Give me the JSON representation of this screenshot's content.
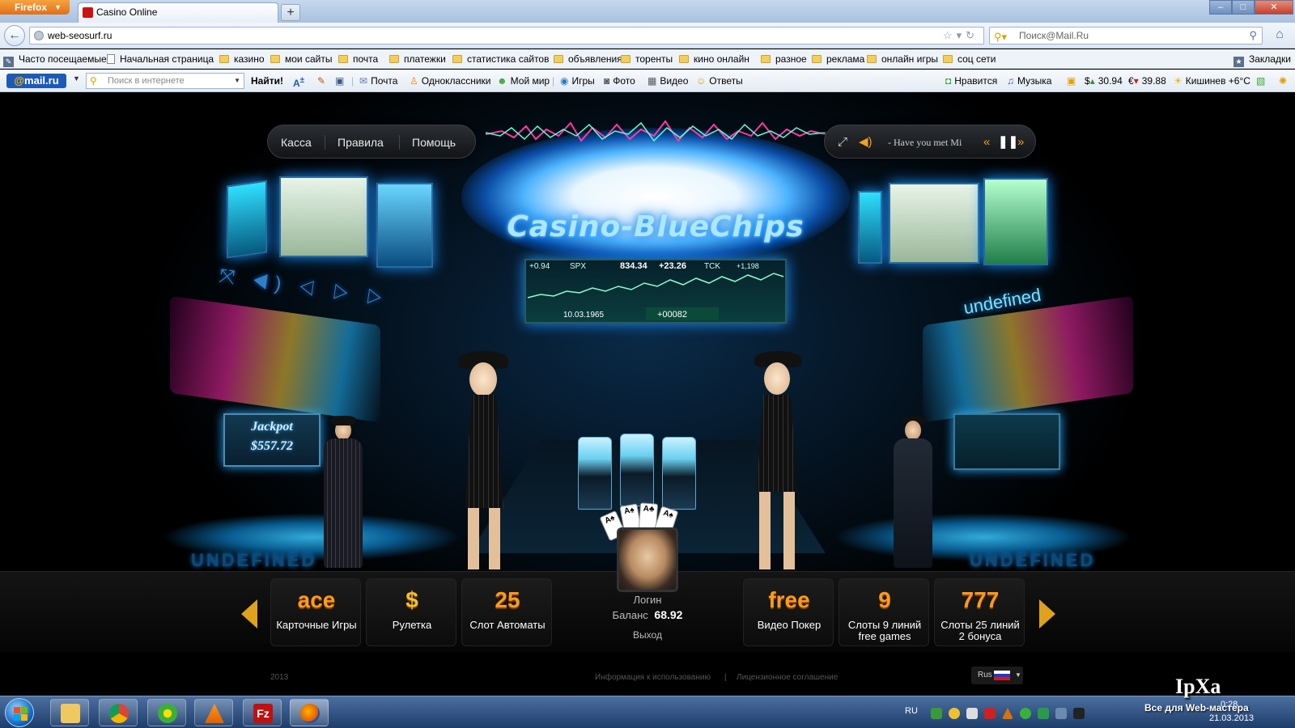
{
  "browser": {
    "app_button": "Firefox",
    "tab_title": "Casino Online",
    "url": "web-seosurf.ru",
    "search_placeholder": "Поиск@Mail.Ru",
    "bookmarks_label": "Закладки",
    "bookmarks": [
      "Часто посещаемые",
      "Начальная страница",
      "казино",
      "мои сайты",
      "почта",
      "платежки",
      "статистика сайтов",
      "объявления",
      "торенты",
      "кино онлайн",
      "разное",
      "реклама",
      "онлайн игры",
      "соц сети"
    ]
  },
  "mail_toolbar": {
    "logo": "mail.ru",
    "search_placeholder": "Поиск в интернете",
    "find_button": "Найти!",
    "items": [
      "Почта",
      "Одноклассники",
      "Мой мир",
      "Игры",
      "Фото",
      "Видео",
      "Ответы"
    ],
    "likes": "Нравится",
    "music": "Музыка",
    "usd": "30.94",
    "eur": "39.88",
    "weather": "Кишинев +6°C"
  },
  "site": {
    "nav": [
      "Касса",
      "Правила",
      "Помощь"
    ],
    "track": "- Have you met Mi",
    "brand": "Casino-BlueChips",
    "ticker": {
      "change_left": "+0.94",
      "symbol": "SPX",
      "price": "834.34",
      "change": "+23.26",
      "symbol2": "TCK",
      "change2": "+1,198",
      "date": "10.03.1965",
      "counter": "+00082"
    },
    "undefined_top": "undefined",
    "undefined_bottom_left": "UNDEFINED",
    "undefined_bottom_right": "UNDEFINED",
    "jackpot_label": "Jackpot",
    "jackpot_value": "$557.72",
    "games_left": [
      {
        "icon": "ace",
        "label": "Карточные Игры",
        "sub": ""
      },
      {
        "icon": "$",
        "label": "Рулетка",
        "sub": ""
      },
      {
        "icon": "25",
        "label": "Слот Автоматы",
        "sub": ""
      }
    ],
    "games_right": [
      {
        "icon": "free",
        "label": "Видео Покер",
        "sub": ""
      },
      {
        "icon": "9",
        "label": "Слоты 9 линий",
        "sub": "free games"
      },
      {
        "icon": "777",
        "label": "Слоты 25 линий",
        "sub": "2 бонуса"
      }
    ],
    "profile": {
      "login": "Логин",
      "balance_label": "Баланс",
      "balance_value": "68.92",
      "logout": "Выход"
    },
    "footer": {
      "year": "2013",
      "info": "Информация к использованию",
      "separator": "|",
      "license": "Лицензионное соглашение",
      "language": "Rus"
    }
  },
  "taskbar": {
    "lang": "RU",
    "time": "0:28",
    "date": "21.03.2013"
  },
  "watermark": {
    "title": "IpXa",
    "subtitle": "Все для Web-мастера"
  }
}
